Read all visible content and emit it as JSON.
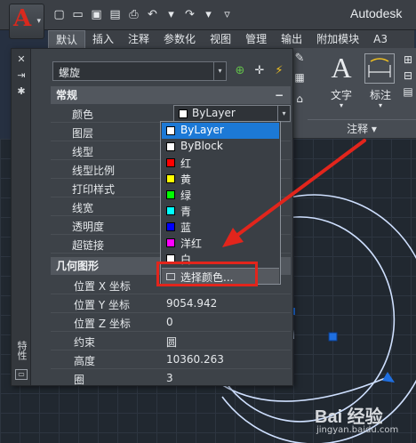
{
  "app": {
    "logo_letter": "A",
    "title": "Autodesk"
  },
  "ribbon": {
    "tabs": [
      "默认",
      "插入",
      "注释",
      "参数化",
      "视图",
      "管理",
      "输出",
      "附加模块",
      "A3"
    ],
    "active_tab": "默认",
    "text_tool": "文字",
    "dim_tool": "标注",
    "annotation_group": "注释 ▾"
  },
  "palette": {
    "object_type": "螺旋",
    "side_title": "特性",
    "general_section": "常规",
    "general_rows": [
      {
        "name": "颜色",
        "value": "ByLayer"
      },
      {
        "name": "图层",
        "value": ""
      },
      {
        "name": "线型",
        "value": ""
      },
      {
        "name": "线型比例",
        "value": ""
      },
      {
        "name": "打印样式",
        "value": ""
      },
      {
        "name": "线宽",
        "value": ""
      },
      {
        "name": "透明度",
        "value": ""
      },
      {
        "name": "超链接",
        "value": ""
      }
    ],
    "geometry_section": "几何图形",
    "geometry_rows": [
      {
        "name": "位置 X 坐标",
        "value": ""
      },
      {
        "name": "位置 Y 坐标",
        "value": "9054.942"
      },
      {
        "name": "位置 Z 坐标",
        "value": "0"
      },
      {
        "name": "约束",
        "value": "圆"
      },
      {
        "name": "高度",
        "value": "10360.263"
      },
      {
        "name": "圈",
        "value": "3"
      }
    ]
  },
  "color_dropdown": {
    "options": [
      {
        "label": "ByLayer",
        "color": "#ffffff",
        "selected": true
      },
      {
        "label": "ByBlock",
        "color": "#ffffff"
      },
      {
        "label": "红",
        "color": "#ff0000"
      },
      {
        "label": "黄",
        "color": "#ffff00"
      },
      {
        "label": "绿",
        "color": "#00ff00"
      },
      {
        "label": "青",
        "color": "#00ffff"
      },
      {
        "label": "蓝",
        "color": "#0000ff"
      },
      {
        "label": "洋红",
        "color": "#ff00ff"
      },
      {
        "label": "白",
        "color": "#ffffff"
      }
    ],
    "choose_color": "选择颜色..."
  },
  "watermark": {
    "brand": "Bai 经验",
    "url": "jingyan.baidu.com"
  },
  "colors": {
    "highlight": "#e2251c",
    "selection": "#1c79d6",
    "helix": "#cfe0ff",
    "grip": "#1f6fe0"
  }
}
